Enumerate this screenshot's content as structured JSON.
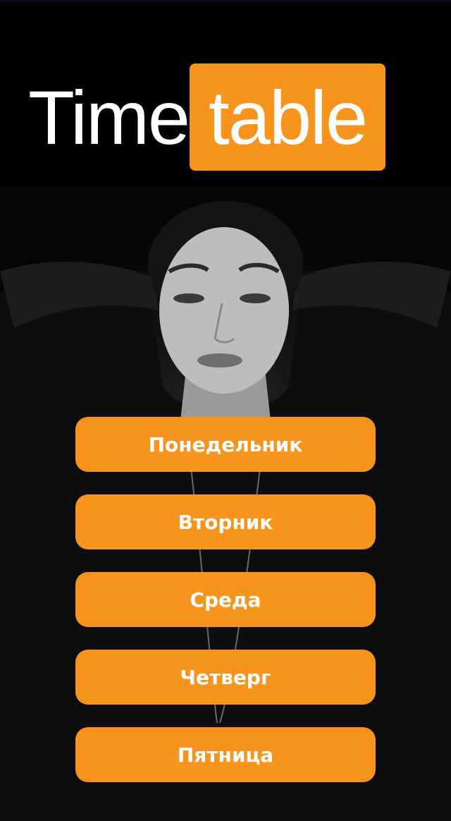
{
  "logo": {
    "part1": "Time",
    "part2": "table"
  },
  "colors": {
    "accent": "#f7941d",
    "background": "#000000",
    "button_text": "#ffffff"
  },
  "background_image": {
    "icon": "portrait-photo"
  },
  "days": [
    {
      "label": "Понедельник"
    },
    {
      "label": "Вторник"
    },
    {
      "label": "Среда"
    },
    {
      "label": "Четверг"
    },
    {
      "label": "Пятница"
    }
  ]
}
